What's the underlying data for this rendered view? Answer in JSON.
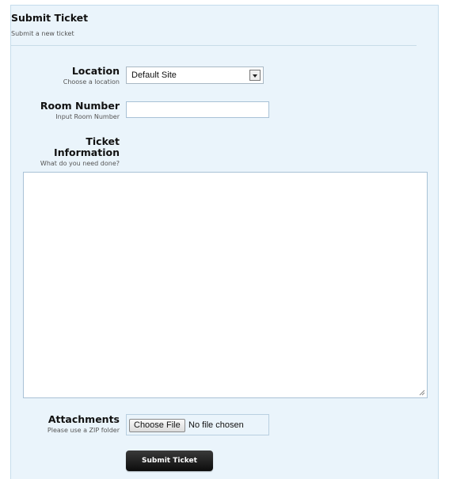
{
  "header": {
    "title": "Submit Ticket",
    "subtitle": "Submit a new ticket"
  },
  "form": {
    "location": {
      "label": "Location",
      "hint": "Choose a location",
      "selected": "Default Site"
    },
    "room_number": {
      "label": "Room Number",
      "hint": "Input Room Number",
      "value": ""
    },
    "ticket_info": {
      "label_line1": "Ticket",
      "label_line2": "Information",
      "hint": "What do you need done?",
      "value": ""
    },
    "attachments": {
      "label": "Attachments",
      "hint": "Please use a ZIP folder",
      "button": "Choose File",
      "status": "No file chosen"
    },
    "submit_label": "Submit Ticket"
  },
  "colors": {
    "panel_bg": "#eaf4fb",
    "panel_border": "#c5dcec",
    "submit_bg": "#111111"
  }
}
